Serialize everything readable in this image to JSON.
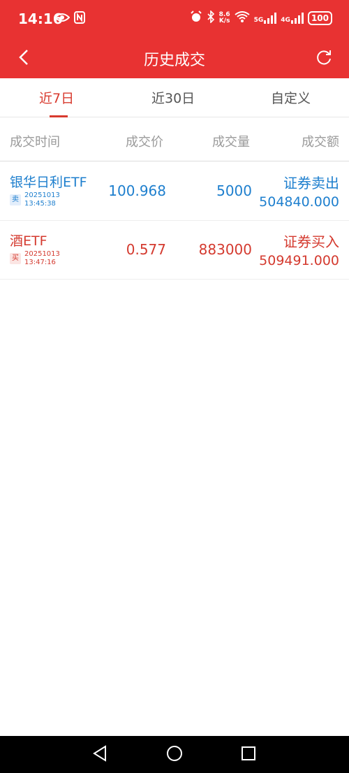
{
  "status": {
    "time": "14:16",
    "speed_top": "8.6",
    "speed_bottom": "K/s",
    "net1": "5G",
    "net2": "4G",
    "battery": "100"
  },
  "title": "历史成交",
  "tabs": [
    {
      "label": "近7日",
      "active": true
    },
    {
      "label": "近30日",
      "active": false
    },
    {
      "label": "自定义",
      "active": false
    }
  ],
  "columns": [
    "成交时间",
    "成交价",
    "成交量",
    "成交额"
  ],
  "trades": [
    {
      "name": "银华日利ETF",
      "side": "卖",
      "date": "20251013",
      "time": "13:45:38",
      "price": "100.968",
      "qty": "5000",
      "op": "证券卖出",
      "amount": "504840.000",
      "color": "#1e7fce"
    },
    {
      "name": "酒ETF",
      "side": "买",
      "date": "20251013",
      "time": "13:47:16",
      "price": "0.577",
      "qty": "883000",
      "op": "证券买入",
      "amount": "509491.000",
      "color": "#d43a2f"
    }
  ],
  "colors": {
    "brand": "#e83232",
    "active_tab": "#d83a2e",
    "sell": "#1e7fce",
    "buy": "#d43a2f"
  },
  "icons": {
    "back": "chevron-left-icon",
    "refresh": "refresh-icon",
    "nav_back": "triangle-back-icon",
    "nav_home": "circle-home-icon",
    "nav_recents": "square-recents-icon"
  }
}
